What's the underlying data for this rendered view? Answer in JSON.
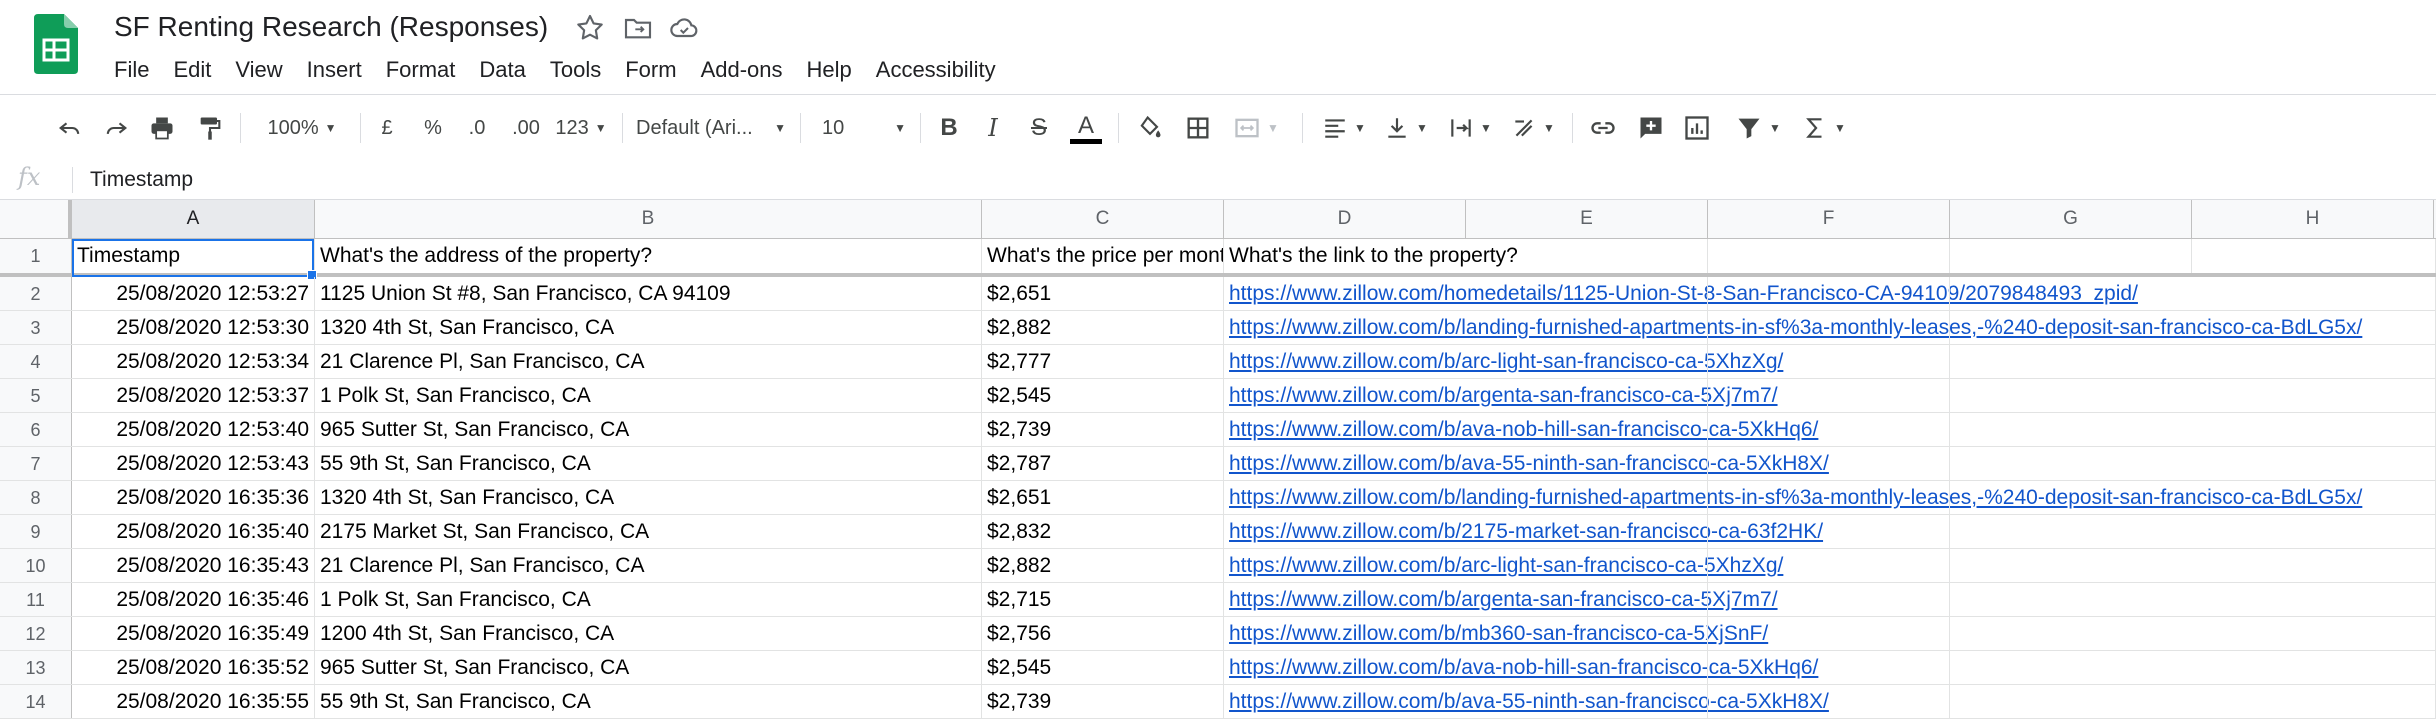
{
  "doc": {
    "title": "SF Renting Research (Responses)"
  },
  "menu": [
    "File",
    "Edit",
    "View",
    "Insert",
    "Format",
    "Data",
    "Tools",
    "Form",
    "Add-ons",
    "Help",
    "Accessibility"
  ],
  "toolbar": {
    "zoom": "100%",
    "currency": "£",
    "percent": "%",
    "dec_less": ".0",
    "dec_more": ".00",
    "more_formats": "123",
    "font": "Default (Ari...",
    "font_size": "10",
    "bold": "B",
    "italic": "I",
    "strike": "S",
    "text_color": "A"
  },
  "formula_bar": {
    "fx": "fx",
    "value": "Timestamp"
  },
  "columns": [
    "A",
    "B",
    "C",
    "D",
    "E",
    "F",
    "G",
    "H"
  ],
  "rows": [
    {
      "n": "1",
      "a": "Timestamp",
      "b": "What's the address of the property?",
      "c": "What's the price per mont",
      "d": "What's the link to the property?"
    },
    {
      "n": "2",
      "a": "25/08/2020 12:53:27",
      "b": "1125 Union St #8, San Francisco, CA 94109",
      "c": "$2,651",
      "d": "https://www.zillow.com/homedetails/1125-Union-St-8-San-Francisco-CA-94109/2079848493_zpid/"
    },
    {
      "n": "3",
      "a": "25/08/2020 12:53:30",
      "b": " 1320 4th St, San Francisco, CA",
      "c": "$2,882",
      "d": "https://www.zillow.com/b/landing-furnished-apartments-in-sf%3a-monthly-leases,-%240-deposit-san-francisco-ca-BdLG5x/"
    },
    {
      "n": "4",
      "a": "25/08/2020 12:53:34",
      "b": " 21 Clarence Pl, San Francisco, CA",
      "c": "$2,777",
      "d": "https://www.zillow.com/b/arc-light-san-francisco-ca-5XhzXg/"
    },
    {
      "n": "5",
      "a": "25/08/2020 12:53:37",
      "b": " 1 Polk St, San Francisco, CA",
      "c": "$2,545",
      "d": "https://www.zillow.com/b/argenta-san-francisco-ca-5Xj7m7/"
    },
    {
      "n": "6",
      "a": "25/08/2020 12:53:40",
      "b": " 965 Sutter St, San Francisco, CA",
      "c": "$2,739",
      "d": "https://www.zillow.com/b/ava-nob-hill-san-francisco-ca-5XkHq6/"
    },
    {
      "n": "7",
      "a": "25/08/2020 12:53:43",
      "b": " 55 9th St, San Francisco, CA",
      "c": "$2,787",
      "d": "https://www.zillow.com/b/ava-55-ninth-san-francisco-ca-5XkH8X/"
    },
    {
      "n": "8",
      "a": "25/08/2020 16:35:36",
      "b": "1320 4th St, San Francisco, CA",
      "c": "$2,651",
      "d": "https://www.zillow.com/b/landing-furnished-apartments-in-sf%3a-monthly-leases,-%240-deposit-san-francisco-ca-BdLG5x/"
    },
    {
      "n": "9",
      "a": "25/08/2020 16:35:40",
      "b": "2175 Market St, San Francisco, CA",
      "c": "$2,832",
      "d": "https://www.zillow.com/b/2175-market-san-francisco-ca-63f2HK/"
    },
    {
      "n": "10",
      "a": "25/08/2020 16:35:43",
      "b": "21 Clarence Pl, San Francisco, CA",
      "c": "$2,882",
      "d": "https://www.zillow.com/b/arc-light-san-francisco-ca-5XhzXg/"
    },
    {
      "n": "11",
      "a": "25/08/2020 16:35:46",
      "b": "1 Polk St, San Francisco, CA",
      "c": "$2,715",
      "d": "https://www.zillow.com/b/argenta-san-francisco-ca-5Xj7m7/"
    },
    {
      "n": "12",
      "a": "25/08/2020 16:35:49",
      "b": "1200 4th St, San Francisco, CA",
      "c": "$2,756",
      "d": "https://www.zillow.com/b/mb360-san-francisco-ca-5XjSnF/"
    },
    {
      "n": "13",
      "a": "25/08/2020 16:35:52",
      "b": "965 Sutter St, San Francisco, CA",
      "c": "$2,545",
      "d": "https://www.zillow.com/b/ava-nob-hill-san-francisco-ca-5XkHq6/"
    },
    {
      "n": "14",
      "a": "25/08/2020 16:35:55",
      "b": "55 9th St, San Francisco, CA",
      "c": "$2,739",
      "d": "https://www.zillow.com/b/ava-55-ninth-san-francisco-ca-5XkH8X/"
    }
  ],
  "colors": {
    "accent": "#1a73e8",
    "link": "#1155cc",
    "logo": "#0f9d58"
  }
}
